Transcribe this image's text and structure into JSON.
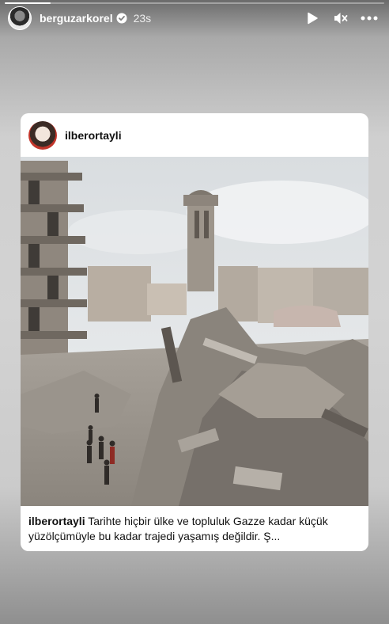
{
  "story": {
    "progress": 0.12,
    "username": "berguzarkorel",
    "verified": true,
    "time": "23s"
  },
  "post": {
    "username": "ilberortayli",
    "caption": "Tarihte hiçbir ülke ve topluluk Gazze kadar küçük yüzölçümüyle bu kadar trajedi yaşamış değildir. Ş..."
  },
  "icons": {
    "play": "play-icon",
    "mute": "mute-icon",
    "more": "more-icon",
    "verified": "verified-badge-icon"
  }
}
